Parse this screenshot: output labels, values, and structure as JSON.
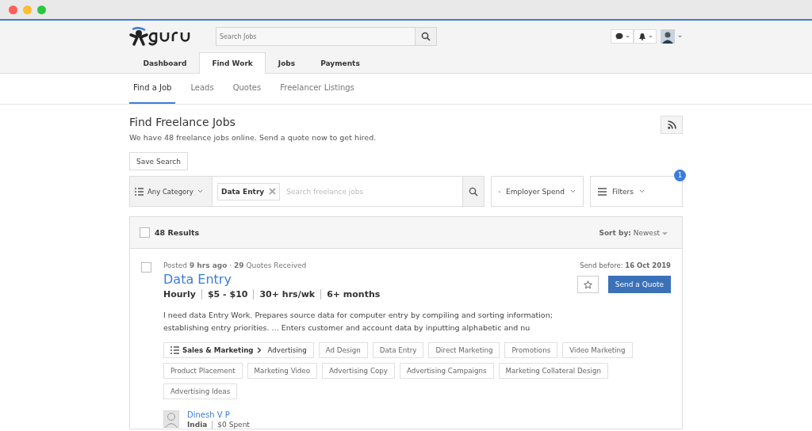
{
  "header": {
    "search": {
      "placeholder": "Search Jobs"
    }
  },
  "nav_tabs": [
    {
      "label": "Dashboard",
      "selected": false
    },
    {
      "label": "Find Work",
      "selected": true
    },
    {
      "label": "Jobs",
      "selected": false
    },
    {
      "label": "Payments",
      "selected": false
    }
  ],
  "sub_tabs": [
    {
      "label": "Find a Job",
      "selected": true
    },
    {
      "label": "Leads",
      "selected": false
    },
    {
      "label": "Quotes",
      "selected": false
    },
    {
      "label": "Freelancer Listings",
      "selected": false
    }
  ],
  "page": {
    "title": "Find Freelance Jobs",
    "subtitle": "We have 48 freelance jobs online. Send a quote now to get hired.",
    "save_button": "Save Search"
  },
  "filter_bar": {
    "category": "Any Category",
    "chip": "Data Entry",
    "placeholder": "Search freelance jobs",
    "employer_spend": "Employer Spend",
    "filters": "Filters",
    "filters_badge": "1"
  },
  "results": {
    "checked": false,
    "count": "48 Results",
    "sort": "**Sort by:** Newest"
  },
  "jobs": [
    {
      "checked": false,
      "posted": "Posted **9 hrs ago** · **29** Quotes Received",
      "send_before": "Send before: **16 Oct 2019**",
      "title": "Data Entry",
      "send_button": "Send a Quote",
      "meta": [
        "Hourly",
        "$5 - $10",
        "30+ hrs/wk",
        "6+ months"
      ],
      "description": "I need data Entry Work. Prepares source data for computer entry by compiling and sorting information; establishing entry priorities. ... Enters customer and account data by inputting alphabetic and nu",
      "tags": [
        {
          "kind": "category",
          "label": "Sales & Marketing",
          "sub": "Advertising"
        },
        {
          "kind": "skill",
          "label": "Ad Design"
        },
        {
          "kind": "skill",
          "label": "Data Entry"
        },
        {
          "kind": "skill",
          "label": "Direct Marketing"
        },
        {
          "kind": "skill",
          "label": "Promotions"
        },
        {
          "kind": "skill",
          "label": "Video Marketing"
        },
        {
          "kind": "skill",
          "label": "Product Placement"
        },
        {
          "kind": "skill",
          "label": "Marketing Video"
        },
        {
          "kind": "skill",
          "label": "Advertising Copy"
        },
        {
          "kind": "skill",
          "label": "Advertising Campaigns"
        },
        {
          "kind": "skill",
          "label": "Marketing Collateral Design"
        },
        {
          "kind": "skill",
          "label": "Advertising Ideas"
        }
      ],
      "employer": {
        "name": "Dinesh V P",
        "country": "India",
        "spent": "$0 Spent"
      }
    }
  ]
}
